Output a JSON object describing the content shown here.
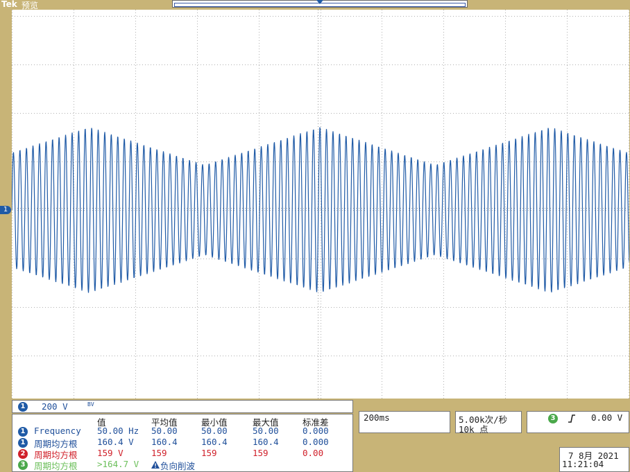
{
  "header": {
    "logo": "Tek",
    "mode": "预览"
  },
  "screen": {
    "ch1_marker": "1"
  },
  "channel": {
    "badge": "1",
    "scale": "200 V",
    "coupling": "BV"
  },
  "measurements": {
    "headers": [
      "值",
      "平均值",
      "最小值",
      "最大值",
      "标准差"
    ],
    "rows": [
      {
        "badge": "1",
        "name": "Frequency",
        "value": "50.00 Hz",
        "mean": "50.00",
        "min": "50.00",
        "max": "50.00",
        "std": "0.000",
        "color": "#1f4f9a"
      },
      {
        "badge": "1",
        "name": "周期均方根",
        "value": "160.4 V",
        "mean": "160.4",
        "min": "160.4",
        "max": "160.4",
        "std": "0.000",
        "color": "#1f4f9a"
      },
      {
        "badge": "2",
        "name": "周期均方根",
        "value": "159 V",
        "mean": "159",
        "min": "159",
        "max": "159",
        "std": "0.00",
        "color": "#d0202a"
      },
      {
        "badge": "3",
        "name": "周期均方根",
        "value": ">164.7 V",
        "warning_icon": "warning-icon",
        "warning": "负向削波",
        "color": "#6bbf5a"
      }
    ]
  },
  "timebase": {
    "scale": "200ms"
  },
  "acquisition": {
    "rate": "5.00k次/秒",
    "points": "10k 点"
  },
  "trigger": {
    "badge": "3",
    "icon": "rising-edge-icon",
    "level": "0.00 V"
  },
  "datetime": {
    "date": "7 8月  2021",
    "time": "11:21:04"
  },
  "colors": {
    "ch1": "#1f5aa6",
    "ch2": "#d0202a",
    "ch3": "#4aa84a",
    "frame": "#c8b477"
  }
}
